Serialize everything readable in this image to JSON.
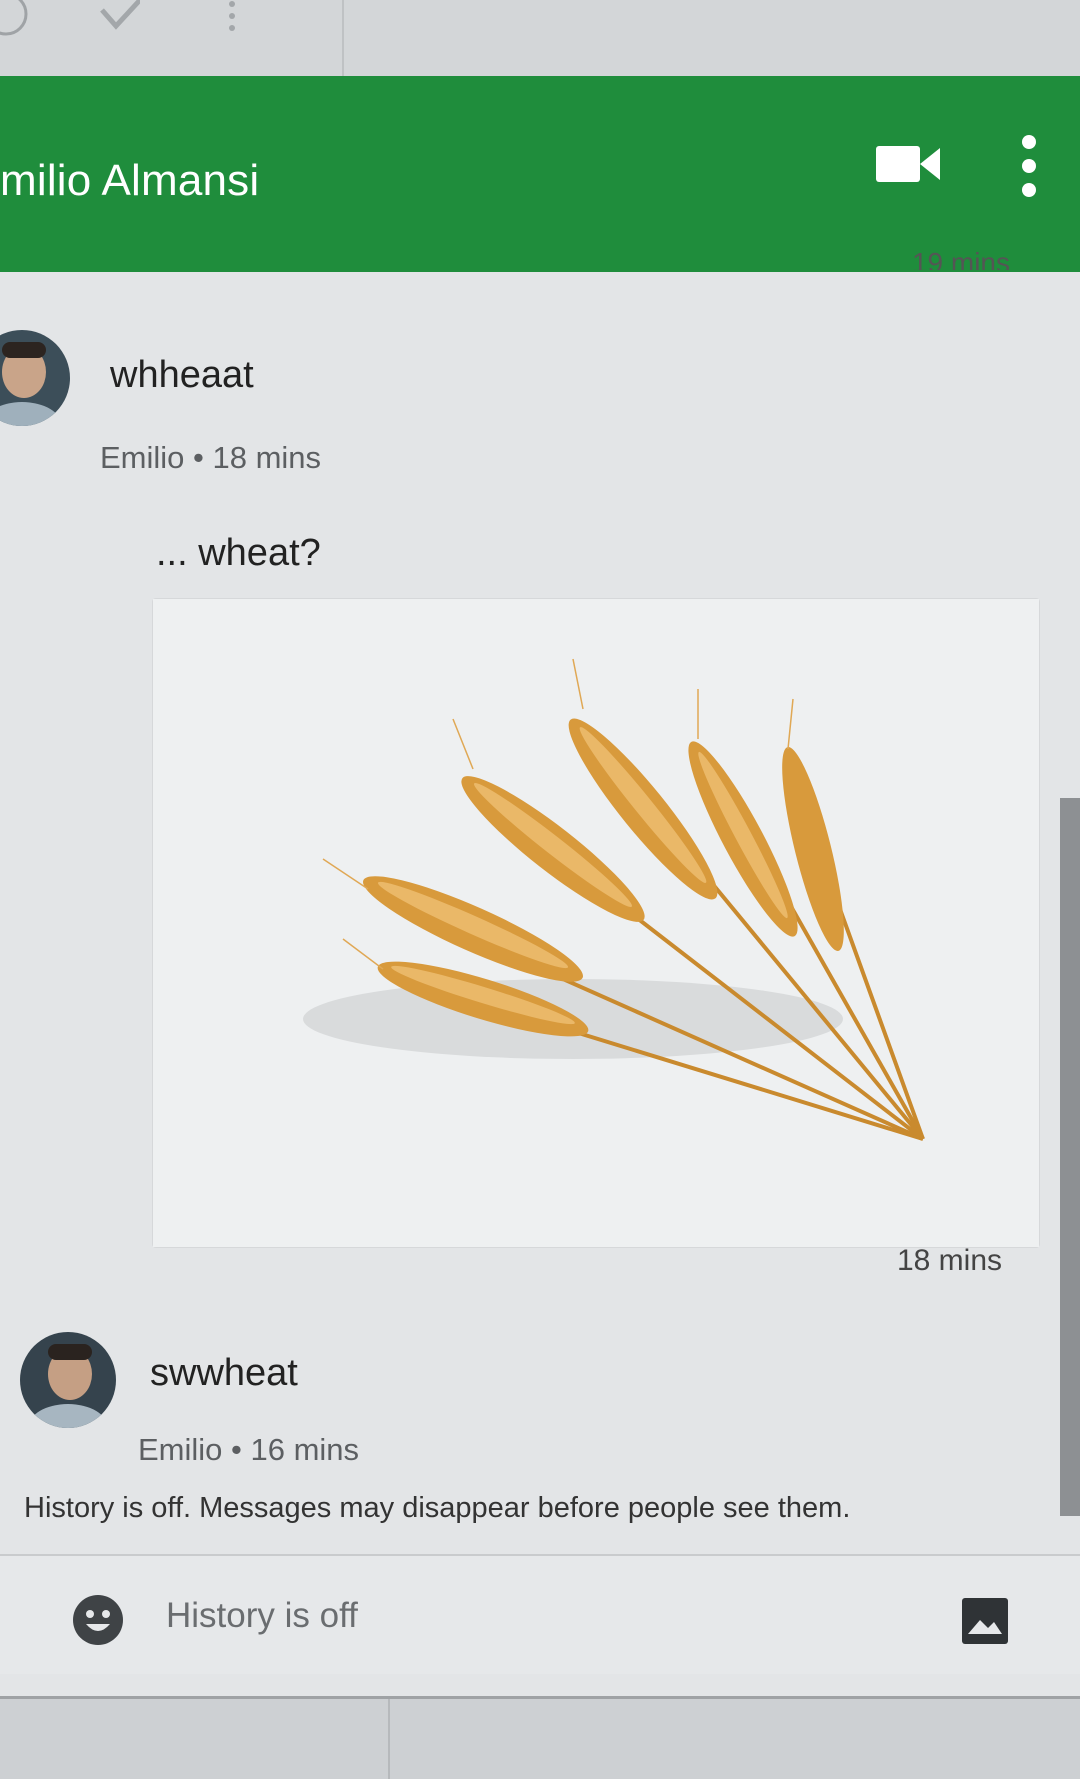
{
  "header": {
    "title": "milio Almansi",
    "video_icon": "video-camera-icon",
    "more_icon": "more-vertical-icon"
  },
  "messages": [
    {
      "time_partial": "19 mins"
    },
    {
      "text": "whheaat",
      "meta": "Emilio • 18 mins",
      "avatar_icon": "avatar-photo"
    },
    {
      "text": "... wheat?",
      "image": "wheat-ears-photo",
      "time": "18 mins"
    },
    {
      "text": "swwheat",
      "meta": "Emilio • 16 mins",
      "avatar_icon": "avatar-photo"
    }
  ],
  "history_note": "History is off. Messages may disappear before people see them.",
  "composer": {
    "placeholder": "History is off",
    "emoji_icon": "emoji-icon",
    "image_icon": "image-icon"
  },
  "colors": {
    "header": "#1f8d3c",
    "background": "#e3e5e7",
    "wheat": "#d89a3c"
  }
}
